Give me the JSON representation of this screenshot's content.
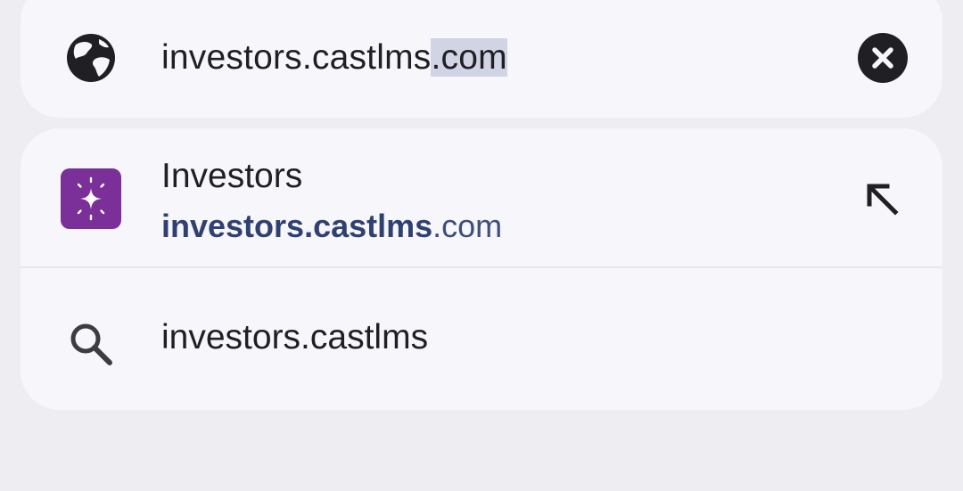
{
  "omnibox": {
    "url_prefix": "investors.castlms",
    "url_selected": ".com",
    "icons": {
      "leading": "globe-icon",
      "trailing": "clear-icon"
    }
  },
  "suggestions": {
    "site": {
      "title": "Investors",
      "url_bold": "investors.castlms",
      "url_rest": ".com",
      "icon": "sparkle-app-icon",
      "icon_color": "#7b2f98",
      "action_icon": "fill-arrow-icon"
    },
    "search": {
      "text": "investors.castlms",
      "icon": "search-icon"
    }
  },
  "colors": {
    "background": "#eeedf2",
    "card": "#f7f6fb",
    "selection": "#d0d4e4",
    "url_bold": "#2e4170"
  }
}
